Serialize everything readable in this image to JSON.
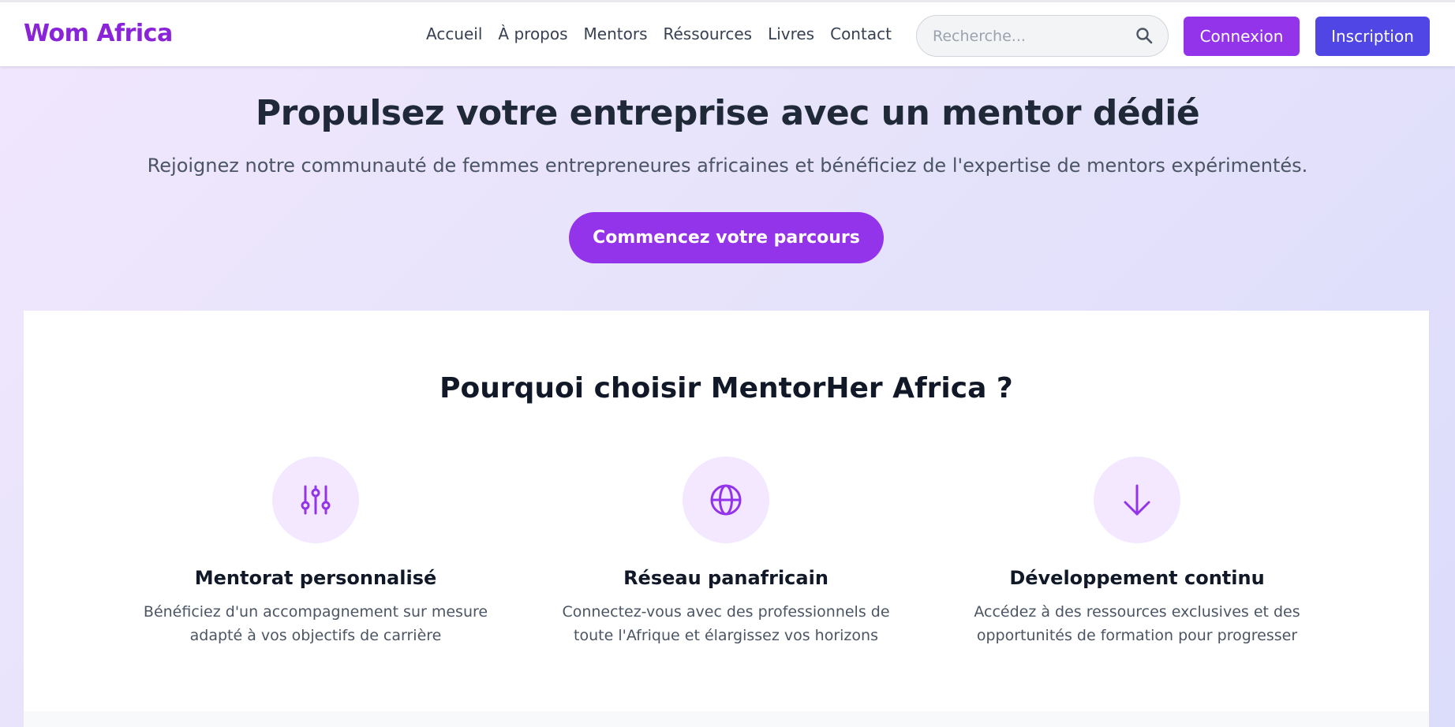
{
  "header": {
    "brand": "Wom Africa",
    "nav": [
      "Accueil",
      "À propos",
      "Mentors",
      "Réssources",
      "Livres",
      "Contact"
    ],
    "search": {
      "placeholder": "Recherche..."
    },
    "login_label": "Connexion",
    "signup_label": "Inscription"
  },
  "hero": {
    "title": "Propulsez votre entreprise avec un mentor dédié",
    "subtitle": "Rejoignez notre communauté de femmes entrepreneures africaines et bénéficiez de l'expertise de mentors expérimentés.",
    "cta_label": "Commencez votre parcours"
  },
  "features": {
    "title": "Pourquoi choisir MentorHer Africa ?",
    "items": [
      {
        "icon": "sliders-icon",
        "title": "Mentorat personnalisé",
        "description": "Bénéficiez d'un accompagnement sur mesure adapté à vos objectifs de carrière"
      },
      {
        "icon": "globe-icon",
        "title": "Réseau panafricain",
        "description": "Connectez-vous avec des professionnels de toute l'Afrique et élargissez vos horizons"
      },
      {
        "icon": "arrow-down-icon",
        "title": "Développement continu",
        "description": "Accédez à des ressources exclusives et des opportunités de formation pour progresser"
      }
    ]
  },
  "colors": {
    "brand": "#8a24d8",
    "primary": "#9333ea",
    "secondary": "#4f46e5",
    "icon_bg": "#f3e8ff"
  }
}
